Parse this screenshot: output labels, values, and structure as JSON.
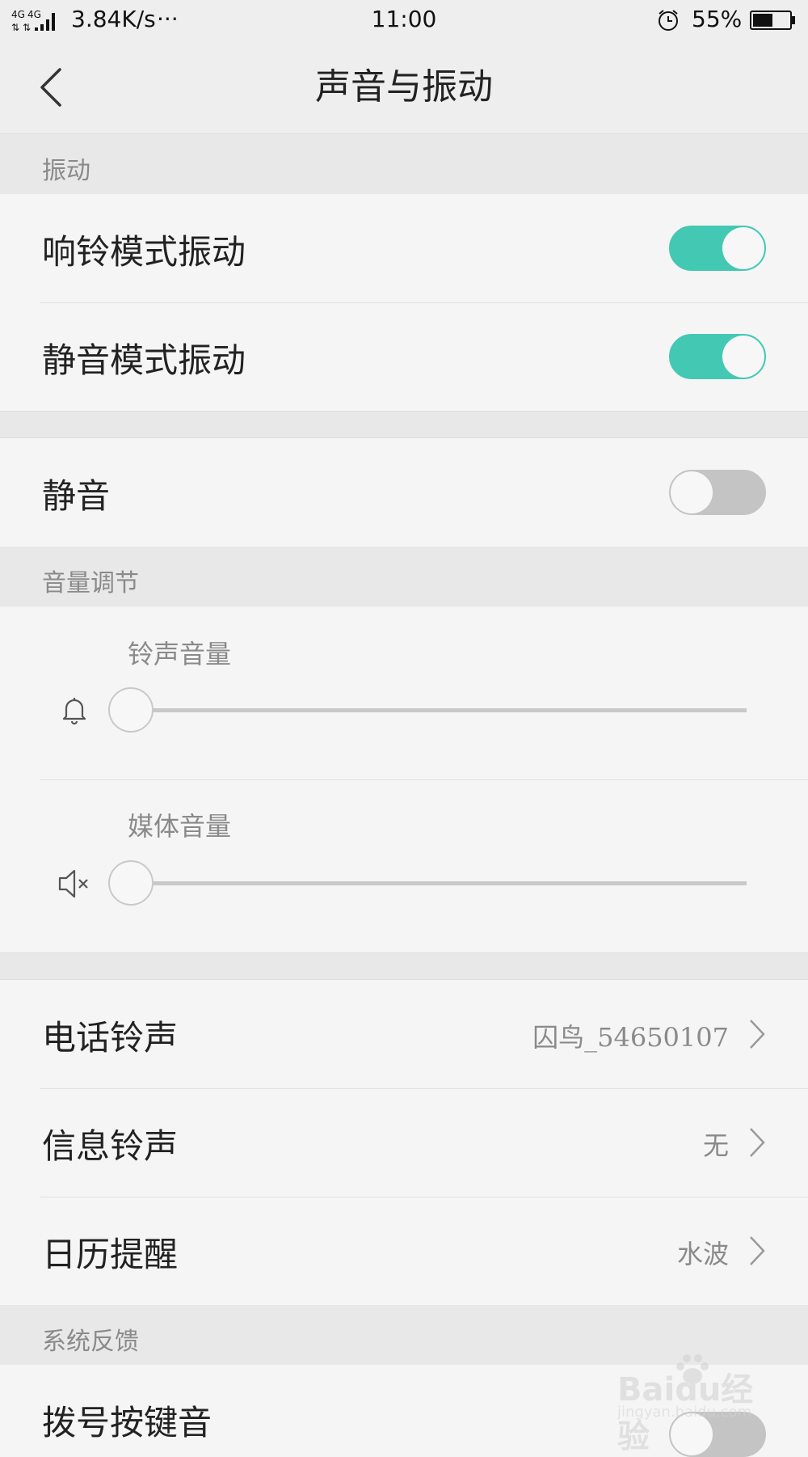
{
  "status_bar": {
    "network": "4G 4G",
    "speed": "3.84K/s",
    "more": "···",
    "time": "11:00",
    "battery_percent": "55%",
    "battery_level": 0.55
  },
  "header": {
    "title": "声音与振动"
  },
  "sections": {
    "vibration": {
      "title": "振动",
      "ring_vibrate": {
        "label": "响铃模式振动",
        "on": true
      },
      "silent_vibrate": {
        "label": "静音模式振动",
        "on": true
      }
    },
    "mute": {
      "label": "静音",
      "on": false
    },
    "volume": {
      "title": "音量调节",
      "ringer": {
        "label": "铃声音量",
        "level": 0
      },
      "media": {
        "label": "媒体音量",
        "level": 0
      }
    },
    "tones": {
      "phone": {
        "label": "电话铃声",
        "value": "囚鸟_54650107"
      },
      "message": {
        "label": "信息铃声",
        "value": "无"
      },
      "calendar": {
        "label": "日历提醒",
        "value": "水波"
      }
    },
    "feedback": {
      "title": "系统反馈",
      "dial_keypad": {
        "label": "拨号按键音",
        "on": false
      }
    }
  },
  "watermark": {
    "brand": "Baidu经验",
    "url": "jingyan.baidu.com"
  },
  "icons": [
    "signal-icon",
    "alarm-icon",
    "battery-icon",
    "back-icon",
    "bell-icon",
    "speaker-mute-icon",
    "chevron-right-icon"
  ],
  "colors": {
    "accent": "#43c8b4",
    "toggle_off": "#c4c4c4",
    "section_bg": "#e8e8e8",
    "row_bg": "#f5f5f5"
  }
}
